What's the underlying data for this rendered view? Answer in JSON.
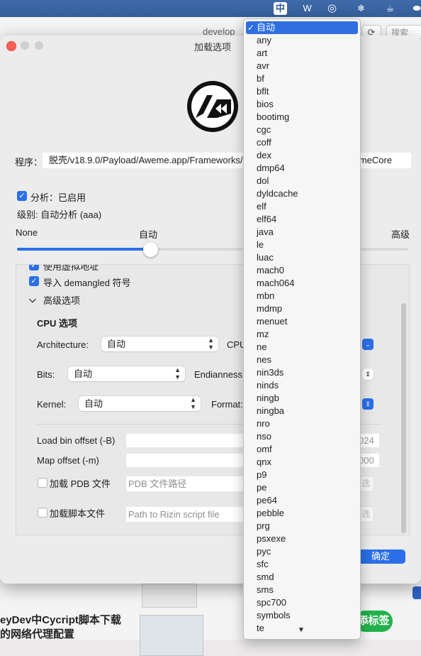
{
  "menubar": {
    "icons": [
      {
        "name": "input-method-icon",
        "glyph": "中"
      },
      {
        "name": "wps-icon",
        "glyph": "W"
      },
      {
        "name": "wechat-icon",
        "glyph": "◎"
      },
      {
        "name": "snowflake-icon",
        "glyph": "❄"
      },
      {
        "name": "cup-icon",
        "glyph": "☕"
      },
      {
        "name": "toggle-icon",
        "glyph": "⬬"
      }
    ]
  },
  "background_window": {
    "title": "develop",
    "refresh_glyph": "⟳",
    "search_placeholder": "搜索",
    "article_line1": "eyDev中Cycript脚本下载",
    "article_line2": "的网络代理配置",
    "green_button": "添标签"
  },
  "dialog": {
    "title": "加载选项",
    "program_label": "程序：",
    "program_value": "脱壳/v18.9.0/Payload/Aweme.app/Frameworks/AwemeCore.framework/AwemeCore",
    "analysis_label": "分析：已启用",
    "level_label": "级别: 自动分析 (aaa)",
    "slider": {
      "left": "None",
      "middle": "自动",
      "right": "高级",
      "value_fraction": 0.34
    },
    "options": {
      "virtual_addr_label": "使用虚拟地址",
      "demangled_label": "导入 demangled 符号",
      "advanced_label": "高级选项",
      "cpu_section": "CPU 选项",
      "architecture_label": "Architecture:",
      "architecture_value": "自动",
      "cpu_label": "CPU",
      "bits_label": "Bits:",
      "bits_value": "自动",
      "endianness_label": "Endianness",
      "kernel_label": "Kernel:",
      "kernel_value": "自动",
      "format_label": "Format:",
      "load_bin_offset_label": "Load bin offset (-B)",
      "load_bin_offset_value": "024",
      "map_offset_label": "Map offset (-m)",
      "map_offset_value": "000",
      "pdb_label": "加载 PDB 文件",
      "pdb_placeholder": "PDB 文件路径",
      "pdb_button": "选",
      "script_label": "加载脚本文件",
      "script_placeholder": "Path to Rizin script file",
      "script_button": "选"
    },
    "ok_button": "确定"
  },
  "popup_menu": {
    "selected": "自动",
    "check_glyph": "✓",
    "items": [
      "any",
      "art",
      "avr",
      "bf",
      "bflt",
      "bios",
      "bootimg",
      "cgc",
      "coff",
      "dex",
      "dmp64",
      "dol",
      "dyldcache",
      "elf",
      "elf64",
      "java",
      "le",
      "luac",
      "mach0",
      "mach064",
      "mbn",
      "mdmp",
      "menuet",
      "mz",
      "ne",
      "nes",
      "nin3ds",
      "ninds",
      "ningb",
      "ningba",
      "nro",
      "nso",
      "omf",
      "qnx",
      "p9",
      "pe",
      "pe64",
      "pebble",
      "prg",
      "psxexe",
      "pyc",
      "sfc",
      "smd",
      "sms",
      "spc700",
      "symbols",
      "te"
    ],
    "scroll_down_glyph": "▼"
  }
}
